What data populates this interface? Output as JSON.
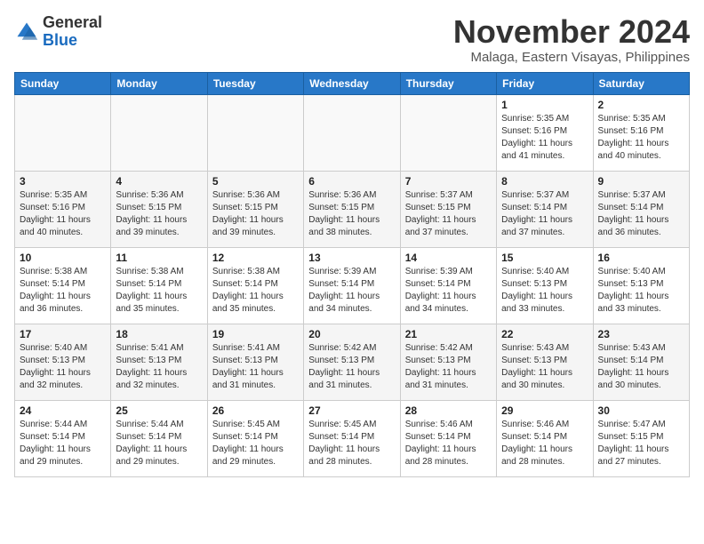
{
  "header": {
    "logo_general": "General",
    "logo_blue": "Blue",
    "month_year": "November 2024",
    "location": "Malaga, Eastern Visayas, Philippines"
  },
  "days_of_week": [
    "Sunday",
    "Monday",
    "Tuesday",
    "Wednesday",
    "Thursday",
    "Friday",
    "Saturday"
  ],
  "weeks": [
    [
      {
        "day": "",
        "info": ""
      },
      {
        "day": "",
        "info": ""
      },
      {
        "day": "",
        "info": ""
      },
      {
        "day": "",
        "info": ""
      },
      {
        "day": "",
        "info": ""
      },
      {
        "day": "1",
        "info": "Sunrise: 5:35 AM\nSunset: 5:16 PM\nDaylight: 11 hours and 41 minutes."
      },
      {
        "day": "2",
        "info": "Sunrise: 5:35 AM\nSunset: 5:16 PM\nDaylight: 11 hours and 40 minutes."
      }
    ],
    [
      {
        "day": "3",
        "info": "Sunrise: 5:35 AM\nSunset: 5:16 PM\nDaylight: 11 hours and 40 minutes."
      },
      {
        "day": "4",
        "info": "Sunrise: 5:36 AM\nSunset: 5:15 PM\nDaylight: 11 hours and 39 minutes."
      },
      {
        "day": "5",
        "info": "Sunrise: 5:36 AM\nSunset: 5:15 PM\nDaylight: 11 hours and 39 minutes."
      },
      {
        "day": "6",
        "info": "Sunrise: 5:36 AM\nSunset: 5:15 PM\nDaylight: 11 hours and 38 minutes."
      },
      {
        "day": "7",
        "info": "Sunrise: 5:37 AM\nSunset: 5:15 PM\nDaylight: 11 hours and 37 minutes."
      },
      {
        "day": "8",
        "info": "Sunrise: 5:37 AM\nSunset: 5:14 PM\nDaylight: 11 hours and 37 minutes."
      },
      {
        "day": "9",
        "info": "Sunrise: 5:37 AM\nSunset: 5:14 PM\nDaylight: 11 hours and 36 minutes."
      }
    ],
    [
      {
        "day": "10",
        "info": "Sunrise: 5:38 AM\nSunset: 5:14 PM\nDaylight: 11 hours and 36 minutes."
      },
      {
        "day": "11",
        "info": "Sunrise: 5:38 AM\nSunset: 5:14 PM\nDaylight: 11 hours and 35 minutes."
      },
      {
        "day": "12",
        "info": "Sunrise: 5:38 AM\nSunset: 5:14 PM\nDaylight: 11 hours and 35 minutes."
      },
      {
        "day": "13",
        "info": "Sunrise: 5:39 AM\nSunset: 5:14 PM\nDaylight: 11 hours and 34 minutes."
      },
      {
        "day": "14",
        "info": "Sunrise: 5:39 AM\nSunset: 5:14 PM\nDaylight: 11 hours and 34 minutes."
      },
      {
        "day": "15",
        "info": "Sunrise: 5:40 AM\nSunset: 5:13 PM\nDaylight: 11 hours and 33 minutes."
      },
      {
        "day": "16",
        "info": "Sunrise: 5:40 AM\nSunset: 5:13 PM\nDaylight: 11 hours and 33 minutes."
      }
    ],
    [
      {
        "day": "17",
        "info": "Sunrise: 5:40 AM\nSunset: 5:13 PM\nDaylight: 11 hours and 32 minutes."
      },
      {
        "day": "18",
        "info": "Sunrise: 5:41 AM\nSunset: 5:13 PM\nDaylight: 11 hours and 32 minutes."
      },
      {
        "day": "19",
        "info": "Sunrise: 5:41 AM\nSunset: 5:13 PM\nDaylight: 11 hours and 31 minutes."
      },
      {
        "day": "20",
        "info": "Sunrise: 5:42 AM\nSunset: 5:13 PM\nDaylight: 11 hours and 31 minutes."
      },
      {
        "day": "21",
        "info": "Sunrise: 5:42 AM\nSunset: 5:13 PM\nDaylight: 11 hours and 31 minutes."
      },
      {
        "day": "22",
        "info": "Sunrise: 5:43 AM\nSunset: 5:13 PM\nDaylight: 11 hours and 30 minutes."
      },
      {
        "day": "23",
        "info": "Sunrise: 5:43 AM\nSunset: 5:14 PM\nDaylight: 11 hours and 30 minutes."
      }
    ],
    [
      {
        "day": "24",
        "info": "Sunrise: 5:44 AM\nSunset: 5:14 PM\nDaylight: 11 hours and 29 minutes."
      },
      {
        "day": "25",
        "info": "Sunrise: 5:44 AM\nSunset: 5:14 PM\nDaylight: 11 hours and 29 minutes."
      },
      {
        "day": "26",
        "info": "Sunrise: 5:45 AM\nSunset: 5:14 PM\nDaylight: 11 hours and 29 minutes."
      },
      {
        "day": "27",
        "info": "Sunrise: 5:45 AM\nSunset: 5:14 PM\nDaylight: 11 hours and 28 minutes."
      },
      {
        "day": "28",
        "info": "Sunrise: 5:46 AM\nSunset: 5:14 PM\nDaylight: 11 hours and 28 minutes."
      },
      {
        "day": "29",
        "info": "Sunrise: 5:46 AM\nSunset: 5:14 PM\nDaylight: 11 hours and 28 minutes."
      },
      {
        "day": "30",
        "info": "Sunrise: 5:47 AM\nSunset: 5:15 PM\nDaylight: 11 hours and 27 minutes."
      }
    ]
  ]
}
